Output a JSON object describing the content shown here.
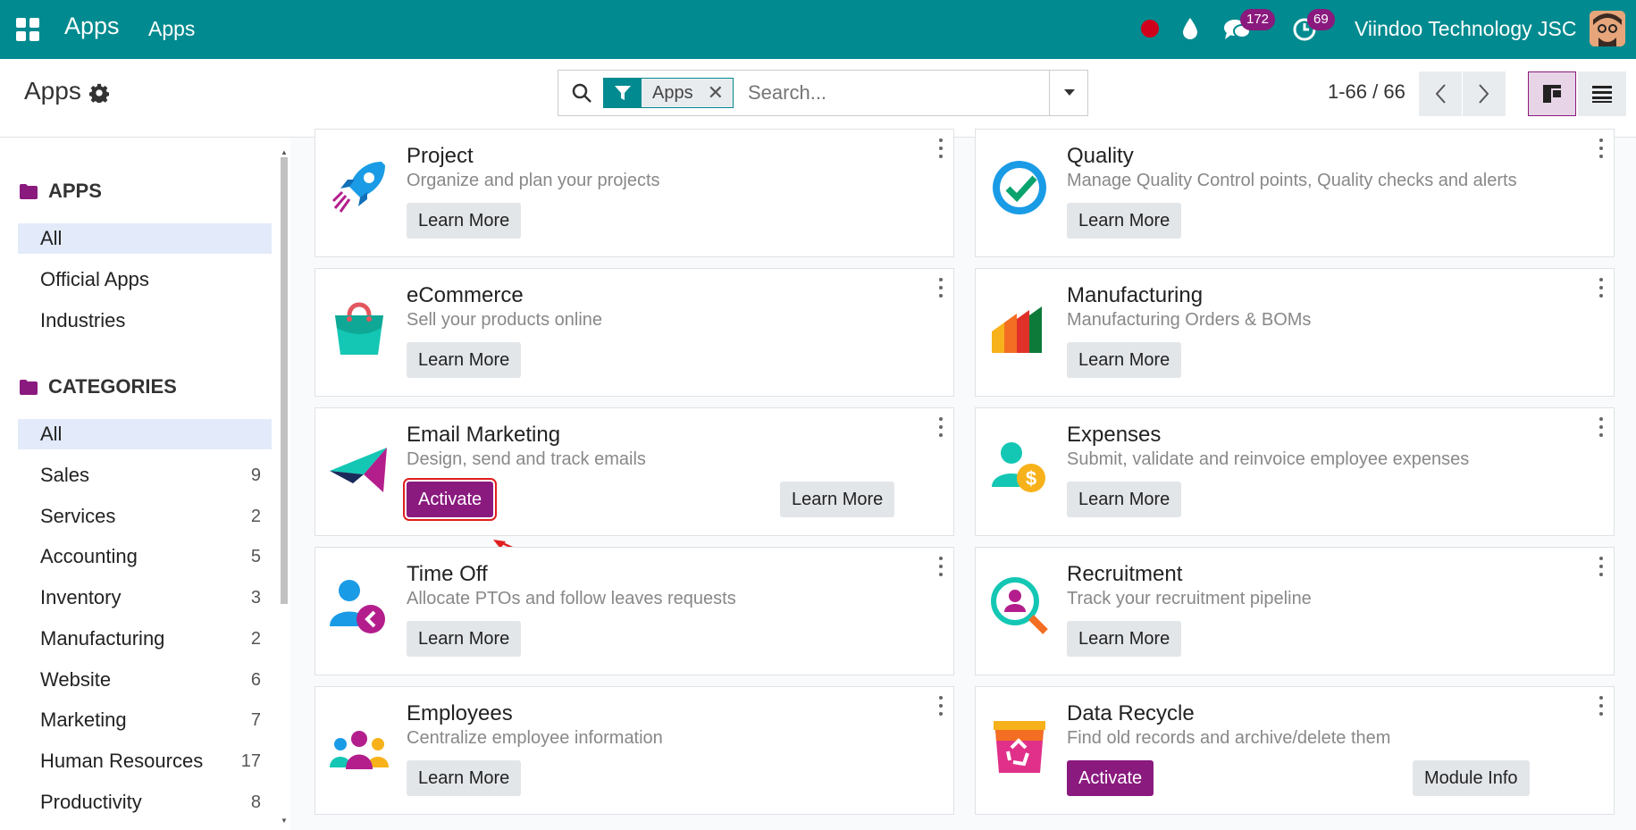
{
  "navbar": {
    "app_title": "Apps",
    "menu_item": "Apps",
    "messages_count": "172",
    "activities_count": "69",
    "company": "Viindoo Technology JSC"
  },
  "control_panel": {
    "title": "Apps",
    "search_facet_value": "Apps",
    "search_placeholder": "Search...",
    "pager_value": "1-66 / 66"
  },
  "sidebar": {
    "apps_header": "APPS",
    "apps_items": [
      {
        "label": "All"
      },
      {
        "label": "Official Apps"
      },
      {
        "label": "Industries"
      }
    ],
    "categories_header": "CATEGORIES",
    "category_items": [
      {
        "label": "All",
        "count": ""
      },
      {
        "label": "Sales",
        "count": "9"
      },
      {
        "label": "Services",
        "count": "2"
      },
      {
        "label": "Accounting",
        "count": "5"
      },
      {
        "label": "Inventory",
        "count": "3"
      },
      {
        "label": "Manufacturing",
        "count": "2"
      },
      {
        "label": "Website",
        "count": "6"
      },
      {
        "label": "Marketing",
        "count": "7"
      },
      {
        "label": "Human Resources",
        "count": "17"
      },
      {
        "label": "Productivity",
        "count": "8"
      }
    ]
  },
  "cards": [
    {
      "name": "Project",
      "desc": "Organize and plan your projects",
      "learn": "Learn More",
      "icon": "rocket-icon"
    },
    {
      "name": "Quality",
      "desc": "Manage Quality Control points, Quality checks and alerts",
      "learn": "Learn More",
      "icon": "quality-badge-icon"
    },
    {
      "name": "eCommerce",
      "desc": "Sell your products online",
      "learn": "Learn More",
      "icon": "shopping-bag-icon"
    },
    {
      "name": "Manufacturing",
      "desc": "Manufacturing Orders & BOMs",
      "learn": "Learn More",
      "icon": "factory-bars-icon"
    },
    {
      "name": "Email Marketing",
      "desc": "Design, send and track emails",
      "activate": "Activate",
      "learn": "Learn More",
      "icon": "paper-plane-icon"
    },
    {
      "name": "Expenses",
      "desc": "Submit, validate and reinvoice employee expenses",
      "learn": "Learn More",
      "icon": "employee-dollar-icon"
    },
    {
      "name": "Time Off",
      "desc": "Allocate PTOs and follow leaves requests",
      "learn": "Learn More",
      "icon": "person-clock-icon"
    },
    {
      "name": "Recruitment",
      "desc": "Track your recruitment pipeline",
      "learn": "Learn More",
      "icon": "magnifier-person-icon"
    },
    {
      "name": "Employees",
      "desc": "Centralize employee information",
      "learn": "Learn More",
      "icon": "people-group-icon"
    },
    {
      "name": "Data Recycle",
      "desc": "Find old records and archive/delete them",
      "activate": "Activate",
      "info": "Module Info",
      "icon": "recycle-bin-icon"
    }
  ],
  "colors": {
    "navbar": "#018a8f",
    "primary": "#8a1a7e",
    "highlight": "#e01e1e"
  }
}
